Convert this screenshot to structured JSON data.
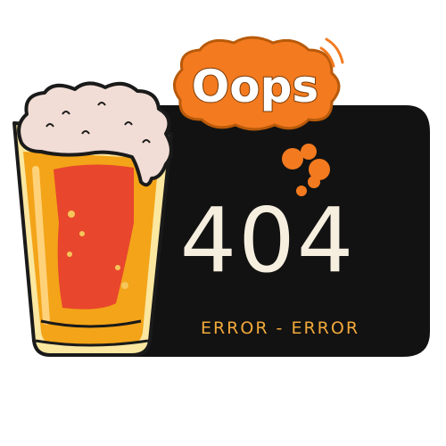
{
  "error": {
    "exclamation": "Oops",
    "code": "404",
    "subtitle": "ERROR - ERROR"
  },
  "illustration": {
    "beer_icon": "beer-glass-icon",
    "thought_icon": "thought-bubble-icon"
  },
  "colors": {
    "panel": "#121212",
    "bubble": "#f37a1f",
    "bubble_dark": "#b85a0a",
    "beer_light": "#f3a418",
    "beer_dark": "#e8462d",
    "foam": "#f1ddd5",
    "outline": "#1a1a1a",
    "code_text": "#f6efe0",
    "subtitle_text": "#f2a93a"
  }
}
